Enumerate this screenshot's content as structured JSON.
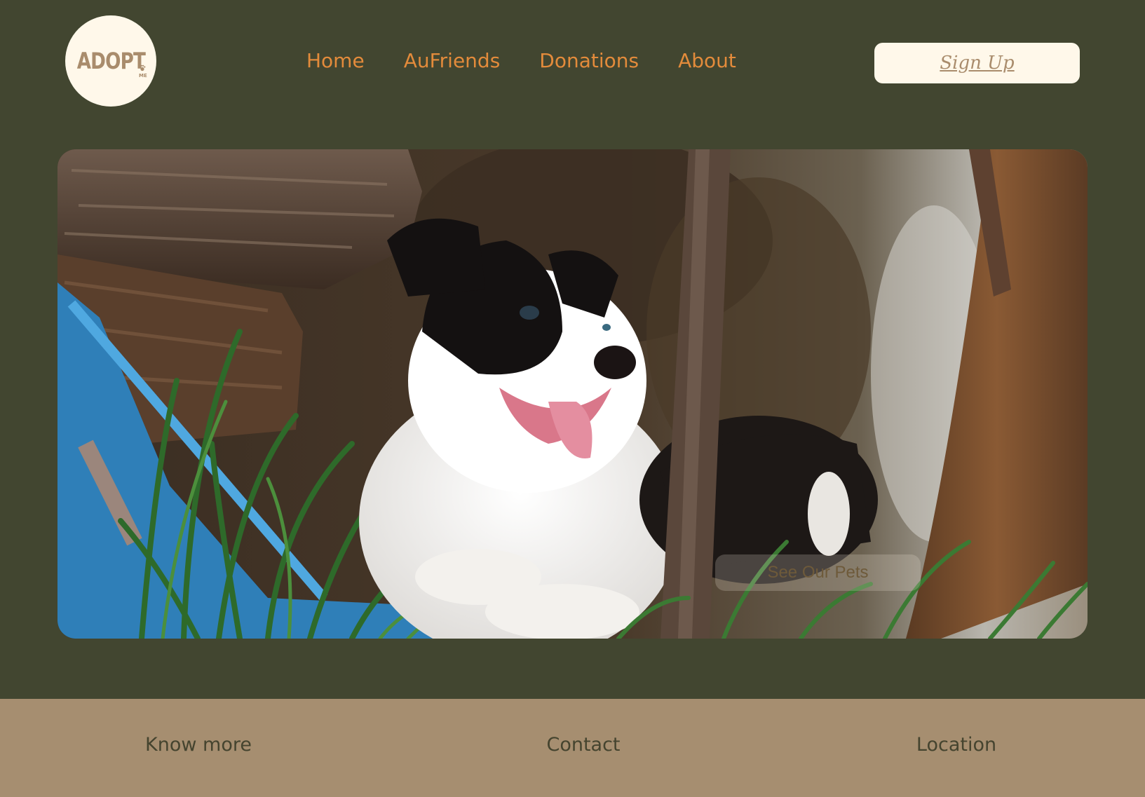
{
  "header": {
    "logo": {
      "text": "ADOPT",
      "suffix": "ME",
      "icon": "paw-icon"
    },
    "nav": [
      {
        "label": "Home"
      },
      {
        "label": "AuFriends"
      },
      {
        "label": "Donations"
      },
      {
        "label": "About"
      }
    ],
    "signup_label": "Sign Up"
  },
  "hero": {
    "image": "puppy-photo",
    "cta_label": "See Our Pets"
  },
  "footer": {
    "links": [
      {
        "label": "Know more"
      },
      {
        "label": "Contact"
      },
      {
        "label": "Location"
      }
    ]
  },
  "colors": {
    "background": "#424630",
    "accent": "#e38b3b",
    "cream": "#fff8ea",
    "tan": "#a68e70",
    "logo_text": "#a98c6c",
    "footer_text": "#45442f"
  }
}
